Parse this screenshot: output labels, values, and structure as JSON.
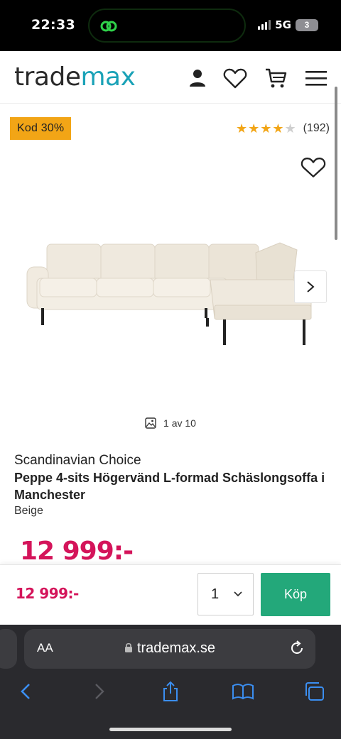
{
  "status_bar": {
    "time": "22:33",
    "network": "5G",
    "battery": "3"
  },
  "header": {
    "logo_part1": "trade",
    "logo_part2": "max",
    "icons": [
      "account-icon",
      "wishlist-icon",
      "cart-icon",
      "menu-icon"
    ]
  },
  "badge": {
    "label": "Kod 30%",
    "color": "#f2a516"
  },
  "rating": {
    "value": 4,
    "max": 5,
    "count": "(192)"
  },
  "gallery": {
    "counter": "1 av 10"
  },
  "product": {
    "brand": "Scandinavian Choice",
    "title": "Peppe 4-sits Högervänd L-formad Schäslongsoffa i Manchester",
    "color": "Beige",
    "price": "12 999:-"
  },
  "sticky_bar": {
    "price": "12 999:-",
    "quantity": "1",
    "buy_label": "Köp"
  },
  "browser": {
    "aa_label": "AA",
    "url": "trademax.se"
  },
  "colors": {
    "accent_price": "#d4145a",
    "buy_button": "#23a87a",
    "brand_teal": "#1aa2b7"
  }
}
